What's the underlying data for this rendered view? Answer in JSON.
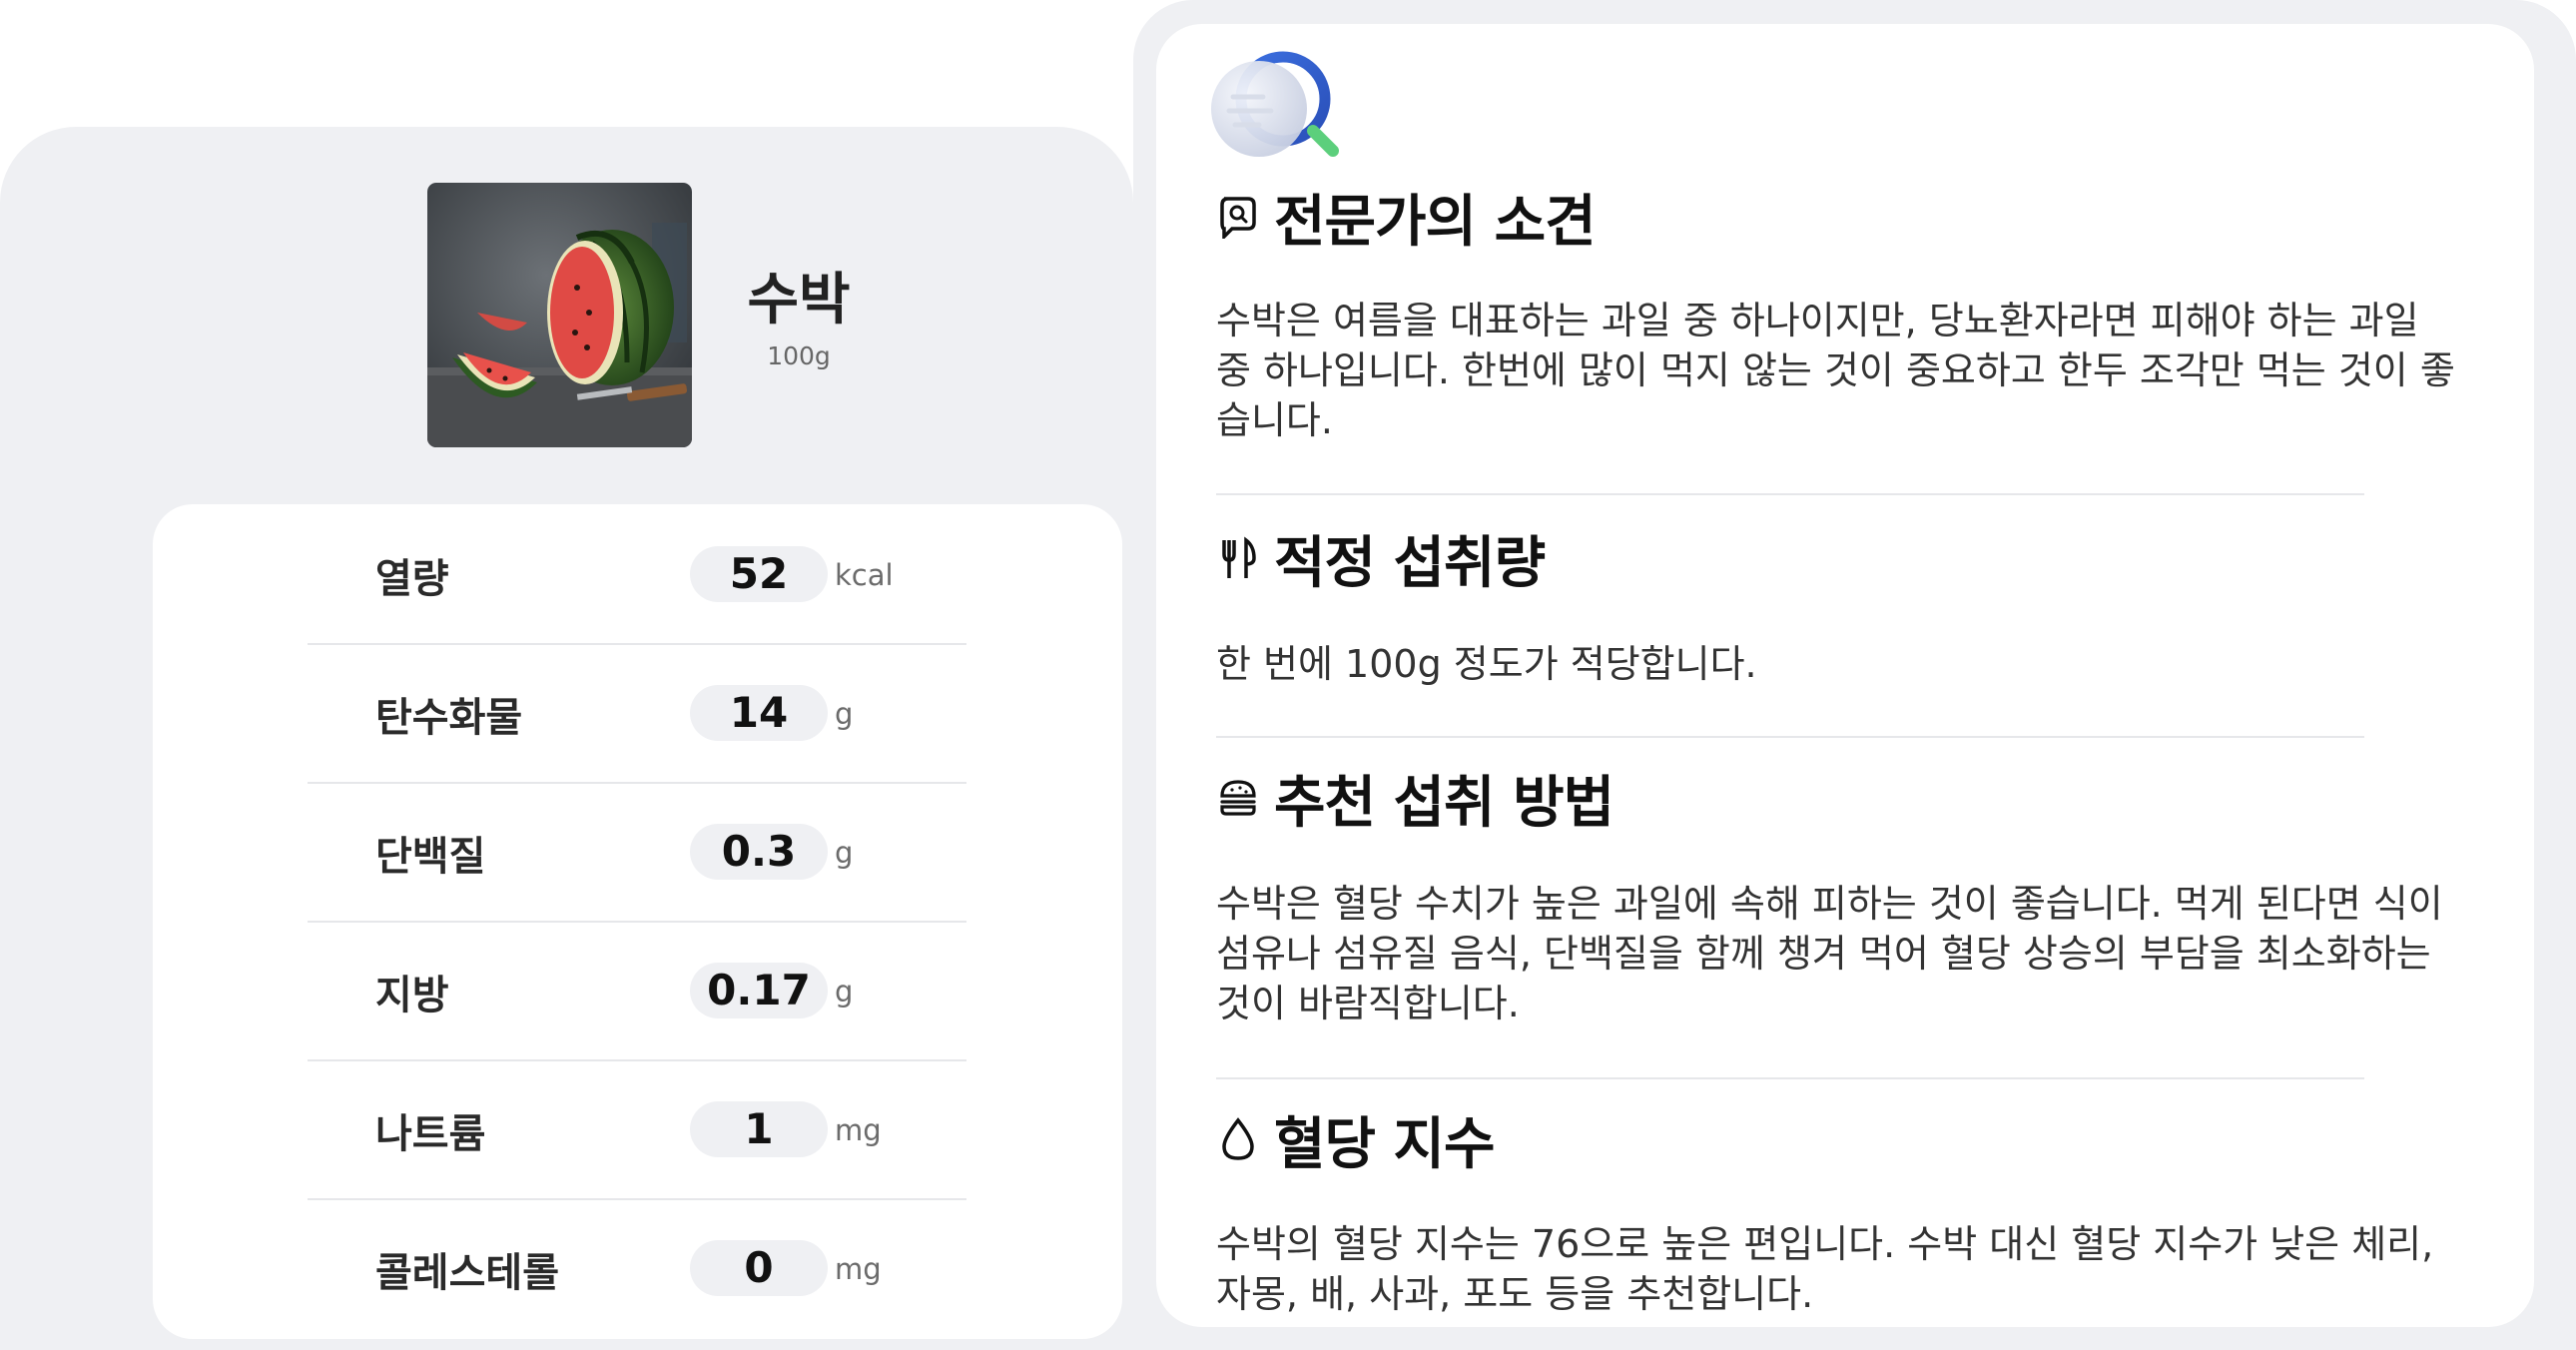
{
  "food": {
    "name": "수박",
    "weight": "100g",
    "image": "watermelon-photo"
  },
  "nutrition": [
    {
      "label": "열량",
      "value": "52",
      "unit": "kcal"
    },
    {
      "label": "탄수화물",
      "value": "14",
      "unit": "g"
    },
    {
      "label": "단백질",
      "value": "0.3",
      "unit": "g"
    },
    {
      "label": "지방",
      "value": "0.17",
      "unit": "g"
    },
    {
      "label": "나트륨",
      "value": "1",
      "unit": "mg"
    },
    {
      "label": "콜레스테롤",
      "value": "0",
      "unit": "mg"
    }
  ],
  "sections": [
    {
      "icon": "chat-search-icon",
      "title": "전문가의 소견",
      "body": "수박은 여름을 대표하는 과일 중 하나이지만, 당뇨환자라면 피해야 하는 과일 중 하나입니다. 한번에 많이 먹지 않는 것이 중요하고 한두 조각만 먹는 것이 좋습니다."
    },
    {
      "icon": "fork-knife-icon",
      "title": "적정 섭취량",
      "body": "한 번에 100g 정도가 적당합니다."
    },
    {
      "icon": "burger-icon",
      "title": "추천 섭취 방법",
      "body": "수박은 혈당 수치가 높은 과일에 속해 피하는 것이 좋습니다. 먹게 된다면 식이섬유나 섬유질 음식, 단백질을 함께 챙겨 먹어 혈당 상승의 부담을 최소화하는 것이 바람직합니다."
    },
    {
      "icon": "water-drop-icon",
      "title": "혈당 지수",
      "body": "수박의 혈당 지수는 76으로 높은 편입니다. 수박 대신 혈당 지수가 낮은 체리, 자몽, 배, 사과, 포도 등을 추천합니다."
    }
  ],
  "colors": {
    "panel_bg": "#eff0f3",
    "card_bg": "#ffffff",
    "logo_blue": "#3b6fe0",
    "logo_green": "#5ccf7c"
  }
}
